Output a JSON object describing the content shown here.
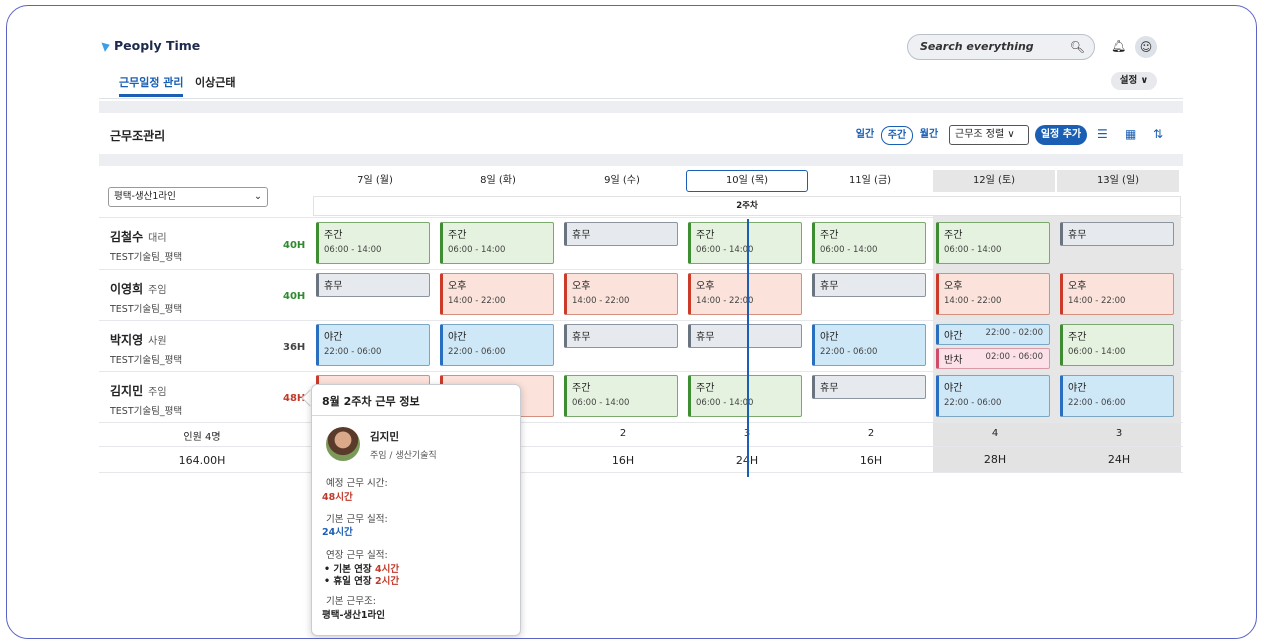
{
  "app": {
    "title": "Peoply Time"
  },
  "search": {
    "placeholder": "Search everything"
  },
  "tabs": [
    {
      "label": "근무일정 관리"
    },
    {
      "label": "이상근태"
    }
  ],
  "settings_label": "설정 ∨",
  "section_title": "근무조관리",
  "view_toggle": [
    "일간",
    "주간",
    "월간"
  ],
  "sort_label": "근무조 정렬  ∨",
  "add_label": "일정 추가",
  "group_select": "평택-생산1라인",
  "days": [
    "7일 (월)",
    "8일 (화)",
    "9일 (수)",
    "10일 (목)",
    "11일 (금)",
    "12일 (토)",
    "13일 (일)"
  ],
  "week_label": "2주차",
  "employees": [
    {
      "name": "김철수",
      "rank": "대리",
      "team": "TEST기술팀_평택",
      "hours": "40H"
    },
    {
      "name": "이영희",
      "rank": "주임",
      "team": "TEST기술팀_평택",
      "hours": "40H"
    },
    {
      "name": "박지영",
      "rank": "사원",
      "team": "TEST기술팀_평택",
      "hours": "36H"
    },
    {
      "name": "김지민",
      "rank": "주임",
      "team": "TEST기술팀_평택",
      "hours": "48H"
    }
  ],
  "shifts": {
    "day_name": "주간",
    "day_time": "06:00 - 14:00",
    "eve_name": "오후",
    "eve_time": "14:00 - 22:00",
    "night_name": "야간",
    "night_time": "22:00 - 06:00",
    "night_time2": "22:00 - 02:00",
    "off_name": "휴무",
    "half_name": "반차",
    "half_time": "02:00 - 06:00"
  },
  "summary": {
    "headcount_label": "인원 4명",
    "total_hours": "164.00H",
    "counts": [
      "2",
      "3",
      "2",
      "4",
      "3"
    ],
    "hours": [
      "16H",
      "24H",
      "16H",
      "28H",
      "24H"
    ]
  },
  "popover": {
    "title": "8월 2주차 근무 정보",
    "name": "김지민",
    "role": "주임 / 생산기술직",
    "planned_label": "예정 근무 시간:",
    "planned_value": "48시간",
    "basic_label": "기본 근무 실적:",
    "basic_value": "24시간",
    "overtime_label": "연장 근무 실적:",
    "ot1_label": "• 기본 연장",
    "ot1_value": "4시간",
    "ot2_label": "• 휴일 연장",
    "ot2_value": "2시간",
    "group_label": "기본 근무조:",
    "group_value": "평택-생산1라인"
  }
}
